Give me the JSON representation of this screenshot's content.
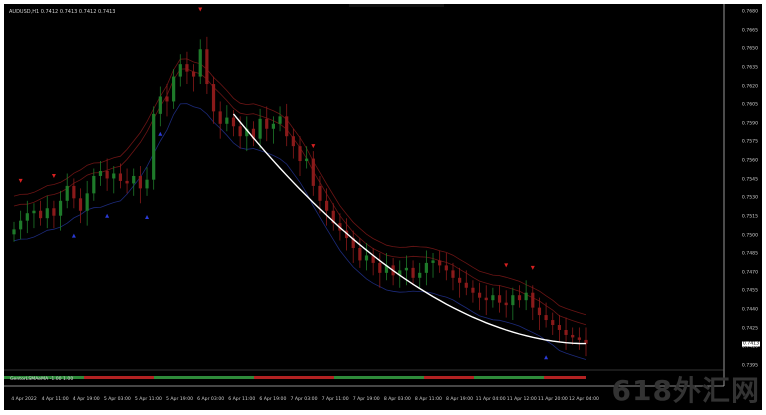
{
  "window": {
    "symbol_label": "AUDUSD,H1  0.7412 0.7413 0.7412 0.7413",
    "indicator_label": "GentorLSMAeMA -1.00 1.00",
    "watermark": "618外汇网"
  },
  "price_axis": {
    "ticks": [
      "0.7680",
      "0.7665",
      "0.7650",
      "0.7635",
      "0.7620",
      "0.7605",
      "0.7590",
      "0.7575",
      "0.7560",
      "0.7545",
      "0.7530",
      "0.7515",
      "0.7500",
      "0.7485",
      "0.7470",
      "0.7455",
      "0.7440",
      "0.7425",
      "0.7410",
      "0.7395"
    ],
    "current_price": "0.7413"
  },
  "time_axis": {
    "ticks": [
      "4 Apr 2022",
      "4 Apr 11:00",
      "4 Apr 19:00",
      "5 Apr 03:00",
      "5 Apr 11:00",
      "5 Apr 19:00",
      "6 Apr 03:00",
      "6 Apr 11:00",
      "6 Apr 19:00",
      "7 Apr 03:00",
      "7 Apr 11:00",
      "7 Apr 19:00",
      "8 Apr 03:00",
      "8 Apr 11:00",
      "8 Apr 19:00",
      "11 Apr 04:00",
      "11 Apr 12:00",
      "11 Apr 20:00",
      "12 Apr 04:00"
    ]
  },
  "colors": {
    "background": "#000000",
    "bull_candle": "#1e7a2a",
    "bear_candle": "#8a1a1a",
    "band": "#6b1414",
    "band_blue": "#1c2a7a",
    "lsma": "#ffffff",
    "arrow_down": "#d62020",
    "arrow_up": "#2a3ad6",
    "axis_text": "#cfcfcf"
  },
  "chart_data": {
    "type": "candlestick",
    "symbol": "AUDUSD",
    "timeframe": "H1",
    "ylim": [
      0.7395,
      0.768
    ],
    "close": [
      0.7505,
      0.7512,
      0.7518,
      0.752,
      0.7514,
      0.7522,
      0.7516,
      0.7528,
      0.754,
      0.753,
      0.752,
      0.7534,
      0.7548,
      0.7552,
      0.7546,
      0.755,
      0.7544,
      0.7542,
      0.7548,
      0.7538,
      0.7545,
      0.7598,
      0.7612,
      0.7608,
      0.7628,
      0.7638,
      0.7632,
      0.7628,
      0.765,
      0.7622,
      0.76,
      0.759,
      0.7595,
      0.7588,
      0.758,
      0.7586,
      0.7578,
      0.7594,
      0.7586,
      0.759,
      0.7596,
      0.758,
      0.7572,
      0.756,
      0.7562,
      0.754,
      0.7528,
      0.752,
      0.751,
      0.7504,
      0.7498,
      0.749,
      0.748,
      0.7484,
      0.7478,
      0.747,
      0.7476,
      0.7468,
      0.7472,
      0.7474,
      0.7466,
      0.747,
      0.7478,
      0.748,
      0.7476,
      0.7472,
      0.7466,
      0.7462,
      0.7458,
      0.7454,
      0.745,
      0.7448,
      0.7452,
      0.7446,
      0.7444,
      0.7452,
      0.7448,
      0.7454,
      0.7442,
      0.7436,
      0.7432,
      0.7428,
      0.7424,
      0.742,
      0.7418,
      0.7416,
      0.7413
    ]
  }
}
